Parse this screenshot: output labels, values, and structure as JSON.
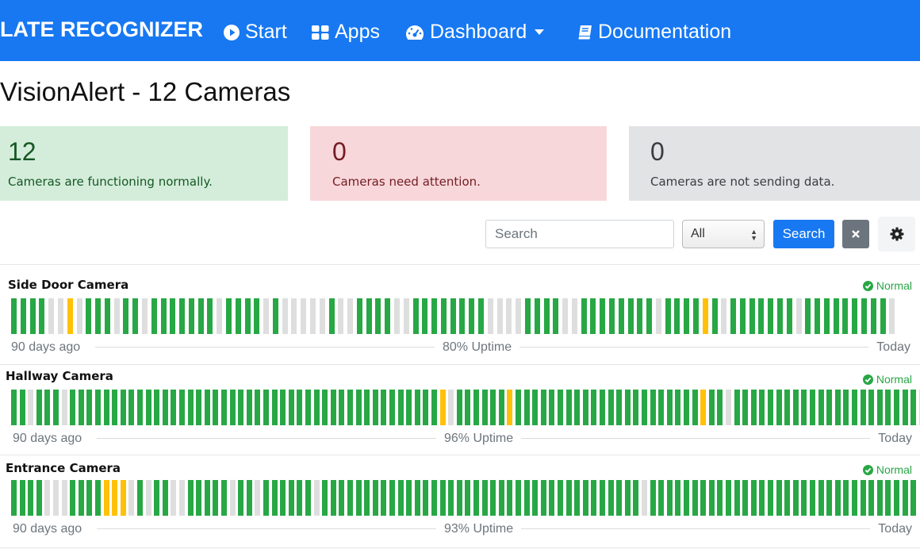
{
  "navbar": {
    "brand": "LATE RECOGNIZER",
    "items": [
      {
        "label": "Start",
        "icon": "play-circle-icon"
      },
      {
        "label": "Apps",
        "icon": "grid-icon"
      },
      {
        "label": "Dashboard",
        "icon": "dashboard-icon"
      },
      {
        "label": "Documentation",
        "icon": "book-icon"
      }
    ]
  },
  "page": {
    "title": "VisionAlert - 12 Cameras"
  },
  "summary": {
    "normal": {
      "count": "12",
      "text": "Cameras are functioning normally."
    },
    "attention": {
      "count": "0",
      "text": "Cameras need attention."
    },
    "offline": {
      "count": "0",
      "text": "Cameras are not sending data."
    }
  },
  "toolbar": {
    "search_placeholder": "Search",
    "filter_value": "All",
    "search_label": "Search"
  },
  "colors": {
    "brand": "#1778f2",
    "up": "#28a745",
    "warn": "#ffc107",
    "none": "#dedede"
  },
  "cameras": [
    {
      "name": "Side Door Camera",
      "status": "Normal",
      "start_label": "90 days ago",
      "uptime": "80% Uptime",
      "end_label": "Today",
      "days": "GGGGNNYNGGGNGGNGGGGGGGNGGGGNGNNNNNGNNGGGGNNGGGGGGGGNNNNGGGGNNGGGGGGGGNGGGGYGNGGGGGGGNGGGGGGGGGN"
    },
    {
      "name": "Hallway Camera",
      "status": "Normal",
      "start_label": "90 days ago",
      "uptime": "96% Uptime",
      "end_label": "Today",
      "days": "GGNGGGNGGGGGGGGGGGGGGGGGGGGGGGGGGGGGGGGGGGGGGGGGGGGYNGGGGGGYGGGGGGGGGGGGGGGGGGGGGGYGGNGGGGGGGGGGGGGGGGGGGGGGNNG"
    },
    {
      "name": "Entrance Camera",
      "status": "Normal",
      "start_label": "90 days ago",
      "uptime": "93% Uptime",
      "end_label": "Today",
      "days": "GGGGNNNGGGGYYYNGNGGNNGGGGGNGGNGGGGGGNGGGGGGGGGGGGGGGGGGGGGGGGGGGGGGGGGGGGGGNGGGGGGGGGGGGGGGGGGGGGGGGGGGGGGGG"
    }
  ]
}
